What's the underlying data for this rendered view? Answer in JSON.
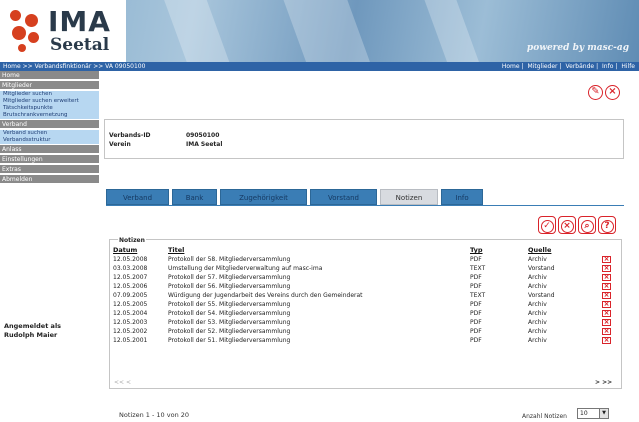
{
  "header": {
    "logo_main": "IMA",
    "logo_sub": "Seetal",
    "powered_by": "powered by masc-ag"
  },
  "topbar": {
    "breadcrumb": "Home >> Verbandsfinktionär >> VA 09050100",
    "links": [
      "Home",
      "Mitglieder",
      "Verbände",
      "Info",
      "Hilfe"
    ]
  },
  "sidebar": {
    "items": [
      {
        "label": "Home",
        "type": "head"
      },
      {
        "label": "Mitglieder",
        "type": "head"
      },
      {
        "label": "Mitglieder suchen",
        "type": "sub"
      },
      {
        "label": "Mitglieder suchen erweitert",
        "type": "sub"
      },
      {
        "label": "Tätschkeitspunkte",
        "type": "sub"
      },
      {
        "label": "Brutschrankvernetzung",
        "type": "sub"
      },
      {
        "label": "Verband",
        "type": "head"
      },
      {
        "label": "Verband suchen",
        "type": "sub"
      },
      {
        "label": "Verbandsstruktur",
        "type": "sub"
      },
      {
        "label": "Anlass",
        "type": "head"
      },
      {
        "label": "Einstellungen",
        "type": "head"
      },
      {
        "label": "Extras",
        "type": "head"
      },
      {
        "label": "Abmelden",
        "type": "head"
      }
    ],
    "login_line1": "Angemeldet als",
    "login_line2": "Rudolph Maier"
  },
  "verband": {
    "id_label": "Verbands-ID",
    "id_value": "09050100",
    "verein_label": "Verein",
    "verein_value": "IMA Seetal"
  },
  "tabs": [
    "Verband",
    "Bank",
    "Zugehörigkeit",
    "Vorstand",
    "Notizen",
    "Info"
  ],
  "active_tab": "Notizen",
  "notes": {
    "legend": "Notizen",
    "columns": {
      "datum": "Datum",
      "titel": "Titel",
      "typ": "Typ",
      "quelle": "Quelle"
    },
    "rows": [
      {
        "datum": "12.05.2008",
        "titel": "Protokoll der 58. Mitgliederversammlung",
        "typ": "PDF",
        "quelle": "Archiv"
      },
      {
        "datum": "03.03.2008",
        "titel": "Umstellung der Mitgliederverwaltung auf masc-ima",
        "typ": "TEXT",
        "quelle": "Vorstand"
      },
      {
        "datum": "12.05.2007",
        "titel": "Protokoll der 57. Mitgliederversammlung",
        "typ": "PDF",
        "quelle": "Archiv"
      },
      {
        "datum": "12.05.2006",
        "titel": "Protokoll der 56. Mitgliederversammlung",
        "typ": "PDF",
        "quelle": "Archiv"
      },
      {
        "datum": "07.09.2005",
        "titel": "Würdigung der Jugendarbeit des Vereins durch den Gemeinderat",
        "typ": "TEXT",
        "quelle": "Vorstand"
      },
      {
        "datum": "12.05.2005",
        "titel": "Protokoll der 55. Mitgliederversammlung",
        "typ": "PDF",
        "quelle": "Archiv"
      },
      {
        "datum": "12.05.2004",
        "titel": "Protokoll der 54. Mitgliederversammlung",
        "typ": "PDF",
        "quelle": "Archiv"
      },
      {
        "datum": "12.05.2003",
        "titel": "Protokoll der 53. Mitgliederversammlung",
        "typ": "PDF",
        "quelle": "Archiv"
      },
      {
        "datum": "12.05.2002",
        "titel": "Protokoll der 52. Mitgliederversammlung",
        "typ": "PDF",
        "quelle": "Archiv"
      },
      {
        "datum": "12.05.2001",
        "titel": "Protokoll der 51. Mitgliederversammlung",
        "typ": "PDF",
        "quelle": "Archiv"
      }
    ],
    "pager_prev": "<< <",
    "pager_next": "> >>"
  },
  "footer": {
    "count_text": "Notizen  1 - 10  von  20",
    "anzahl_label": "Anzahl Notizen",
    "anzahl_value": "10"
  },
  "colors": {
    "accent_blue": "#2e63a6",
    "tab_blue": "#3a7db5",
    "icon_red": "#d9232a",
    "sidebar_gray": "#8a8a8a",
    "sidebar_sub": "#b7d7f1"
  }
}
